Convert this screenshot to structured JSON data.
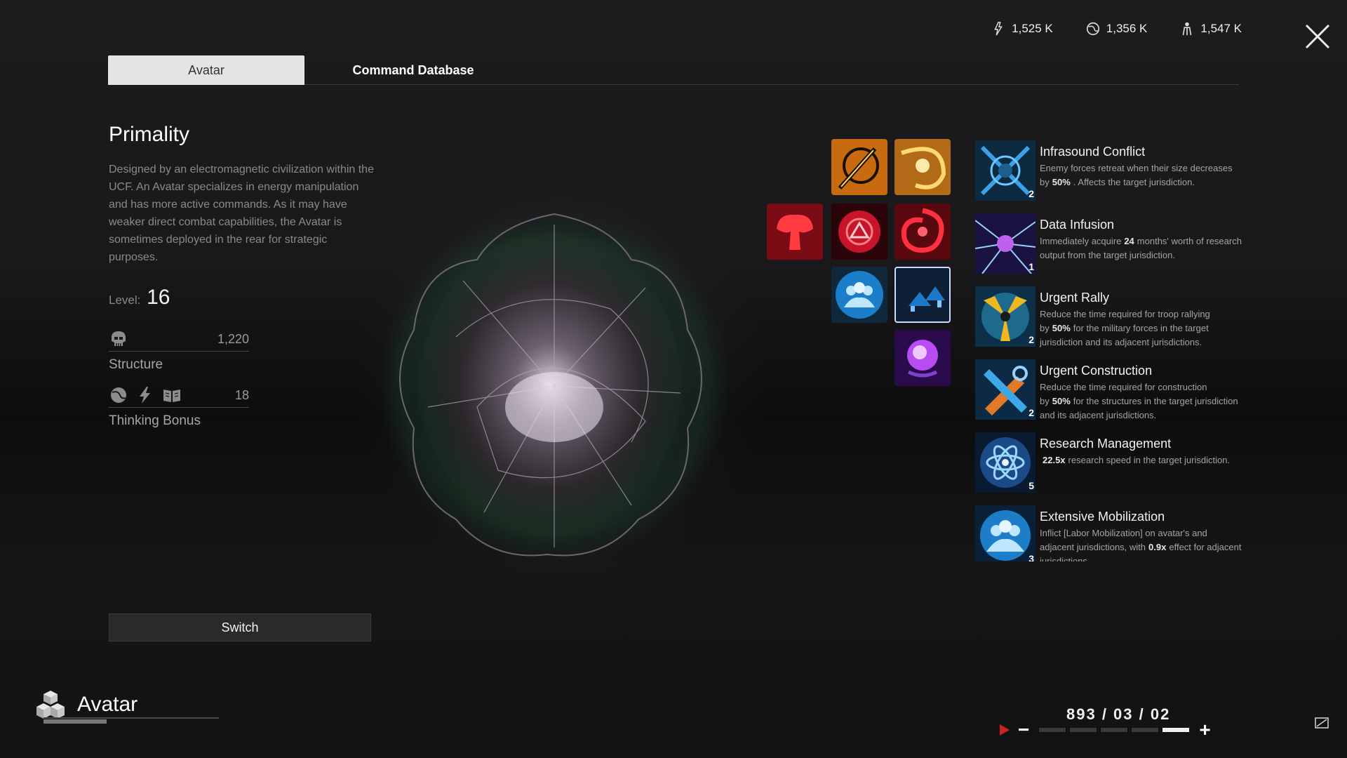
{
  "resources": [
    {
      "icon": "energy-icon",
      "value": "1,525 K"
    },
    {
      "icon": "planet-icon",
      "value": "1,356 K"
    },
    {
      "icon": "population-icon",
      "value": "1,547 K"
    }
  ],
  "tabs": [
    {
      "label": "Avatar",
      "active": true
    },
    {
      "label": "Command Database",
      "active": false
    }
  ],
  "avatar": {
    "name": "Primality",
    "description": "Designed by an electromagnetic civilization within the UCF. An Avatar specializes in energy manipulation and has more active commands. As it may have weaker direct combat capabilities, the Avatar is sometimes deployed in the rear for strategic purposes.",
    "level_label": "Level:",
    "level": "16",
    "structure_value": "1,220",
    "structure_label": "Structure",
    "thinking_value": "18",
    "thinking_label": "Thinking Bonus",
    "switch_label": "Switch"
  },
  "commands": [
    {
      "name": "cmd-lance",
      "color": "#f0a020"
    },
    {
      "name": "cmd-vortex",
      "color": "#e0a030"
    },
    {
      "name": "cmd-blast",
      "color": "#d02030"
    },
    {
      "name": "cmd-target",
      "color": "#d02030"
    },
    {
      "name": "cmd-swirl",
      "color": "#c02030"
    },
    {
      "name": "cmd-crowd",
      "color": "#2a90e0"
    },
    {
      "name": "cmd-arrows",
      "color": "#2a70c0",
      "selected": true
    },
    {
      "name": "cmd-nebula",
      "color": "#9a40e0"
    }
  ],
  "skills": [
    {
      "name": "Infrasound Conflict",
      "count": "2",
      "desc_pre": "Enemy forces retreat when their size decreases by",
      "value": "50%",
      "desc_post": ". Affects the target jurisdiction."
    },
    {
      "name": "Data Infusion",
      "count": "1",
      "desc_pre": "Immediately acquire",
      "value": "24",
      "desc_post": "months' worth of research output from the target jurisdiction."
    },
    {
      "name": "Urgent Rally",
      "count": "2",
      "desc_pre": "Reduce the time required for troop rallying by",
      "value": "50%",
      "desc_post": "for the military forces in the target jurisdiction and its adjacent jurisdictions."
    },
    {
      "name": "Urgent Construction",
      "count": "2",
      "desc_pre": "Reduce the time required for construction by",
      "value": "50%",
      "desc_post": "for the structures in the target jurisdiction and its adjacent jurisdictions."
    },
    {
      "name": "Research Management",
      "count": "5",
      "desc_pre": "",
      "value": "22.5x",
      "desc_post": "research speed in the target jurisdiction."
    },
    {
      "name": "Extensive Mobilization",
      "count": "3",
      "desc_pre": "Inflict [Labor Mobilization] on avatar's and adjacent jurisdictions, with",
      "value": "0.9x",
      "desc_post": "effect for adjacent jurisdictions."
    }
  ],
  "footer": {
    "title": "Avatar",
    "date": "893 / 03 / 02",
    "minus": "−",
    "plus": "+"
  },
  "timeline_level": 5
}
